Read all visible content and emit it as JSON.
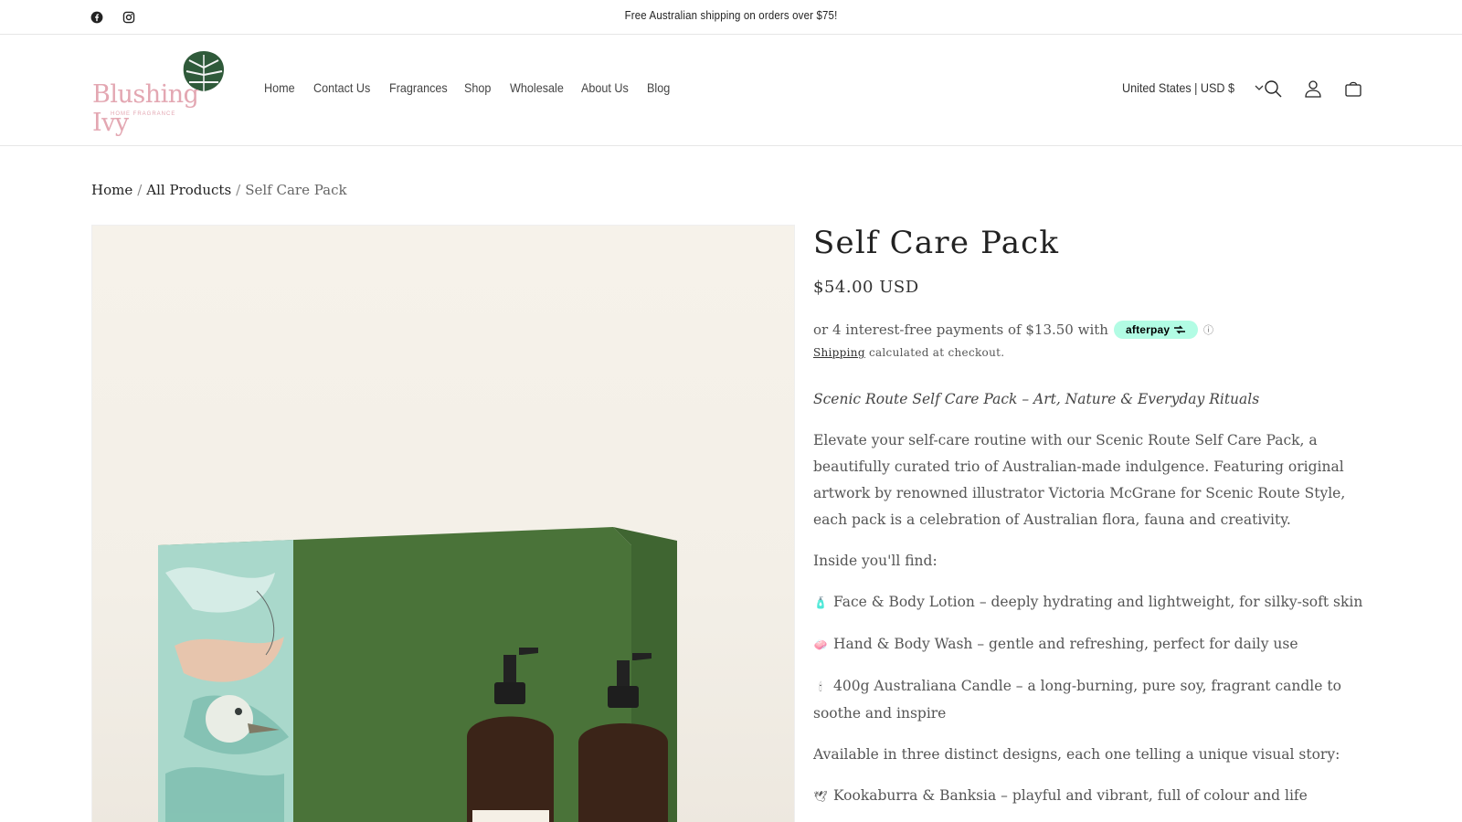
{
  "announcement": {
    "text": "Free Australian shipping on orders over $75!"
  },
  "social": {
    "facebook_icon": "facebook-icon",
    "instagram_icon": "instagram-icon"
  },
  "logo": {
    "text": "Blushing Ivy",
    "subtext": "HOME FRAGRANCE"
  },
  "nav": {
    "items": [
      {
        "label": "Home"
      },
      {
        "label": "Contact Us"
      },
      {
        "label": "Fragrances"
      },
      {
        "label": "Shop"
      },
      {
        "label": "Wholesale"
      },
      {
        "label": "About Us"
      },
      {
        "label": "Blog"
      }
    ]
  },
  "header": {
    "country": "United States | USD $",
    "icons": [
      "search-icon",
      "account-icon",
      "cart-icon"
    ]
  },
  "breadcrumb": {
    "home": "Home",
    "all_products": "All Products",
    "current": "Self Care Pack",
    "separator": "/"
  },
  "product": {
    "title": "Self Care Pack",
    "price": "$54.00 USD",
    "afterpay_text": "or 4 interest-free payments of $13.50 with",
    "afterpay_badge": "afterpay",
    "afterpay_info": "ⓘ",
    "shipping_link": "Shipping",
    "shipping_text": "calculated at checkout.",
    "tagline": "Scenic Route Self Care Pack – Art, Nature & Everyday Rituals",
    "intro": "Elevate your self-care routine with our Scenic Route Self Care Pack, a beautifully curated trio of Australian-made indulgence. Featuring original artwork by renowned illustrator Victoria McGrane for Scenic Route Style, each pack is a celebration of Australian flora, fauna and creativity.",
    "inside_heading": "Inside you'll find:",
    "items": [
      {
        "emoji": "🧴",
        "text": "Face & Body Lotion – deeply hydrating and lightweight, for silky-soft skin"
      },
      {
        "emoji": "🧼",
        "text": "Hand & Body Wash – gentle and refreshing, perfect for daily use"
      },
      {
        "emoji": "🕯",
        "text": "400g Australiana Candle – a long-burning, pure soy, fragrant candle to soothe and inspire"
      }
    ],
    "designs_heading": "Available in three distinct designs, each one telling a unique visual story:",
    "designs": [
      {
        "emoji": "🕊",
        "text": "Kookaburra & Banksia – playful and vibrant, full of colour and life"
      }
    ]
  },
  "colors": {
    "accent_green": "#4f7a3c",
    "afterpay_mint": "#b2fce4",
    "logo_pink": "#e3a7b2"
  }
}
